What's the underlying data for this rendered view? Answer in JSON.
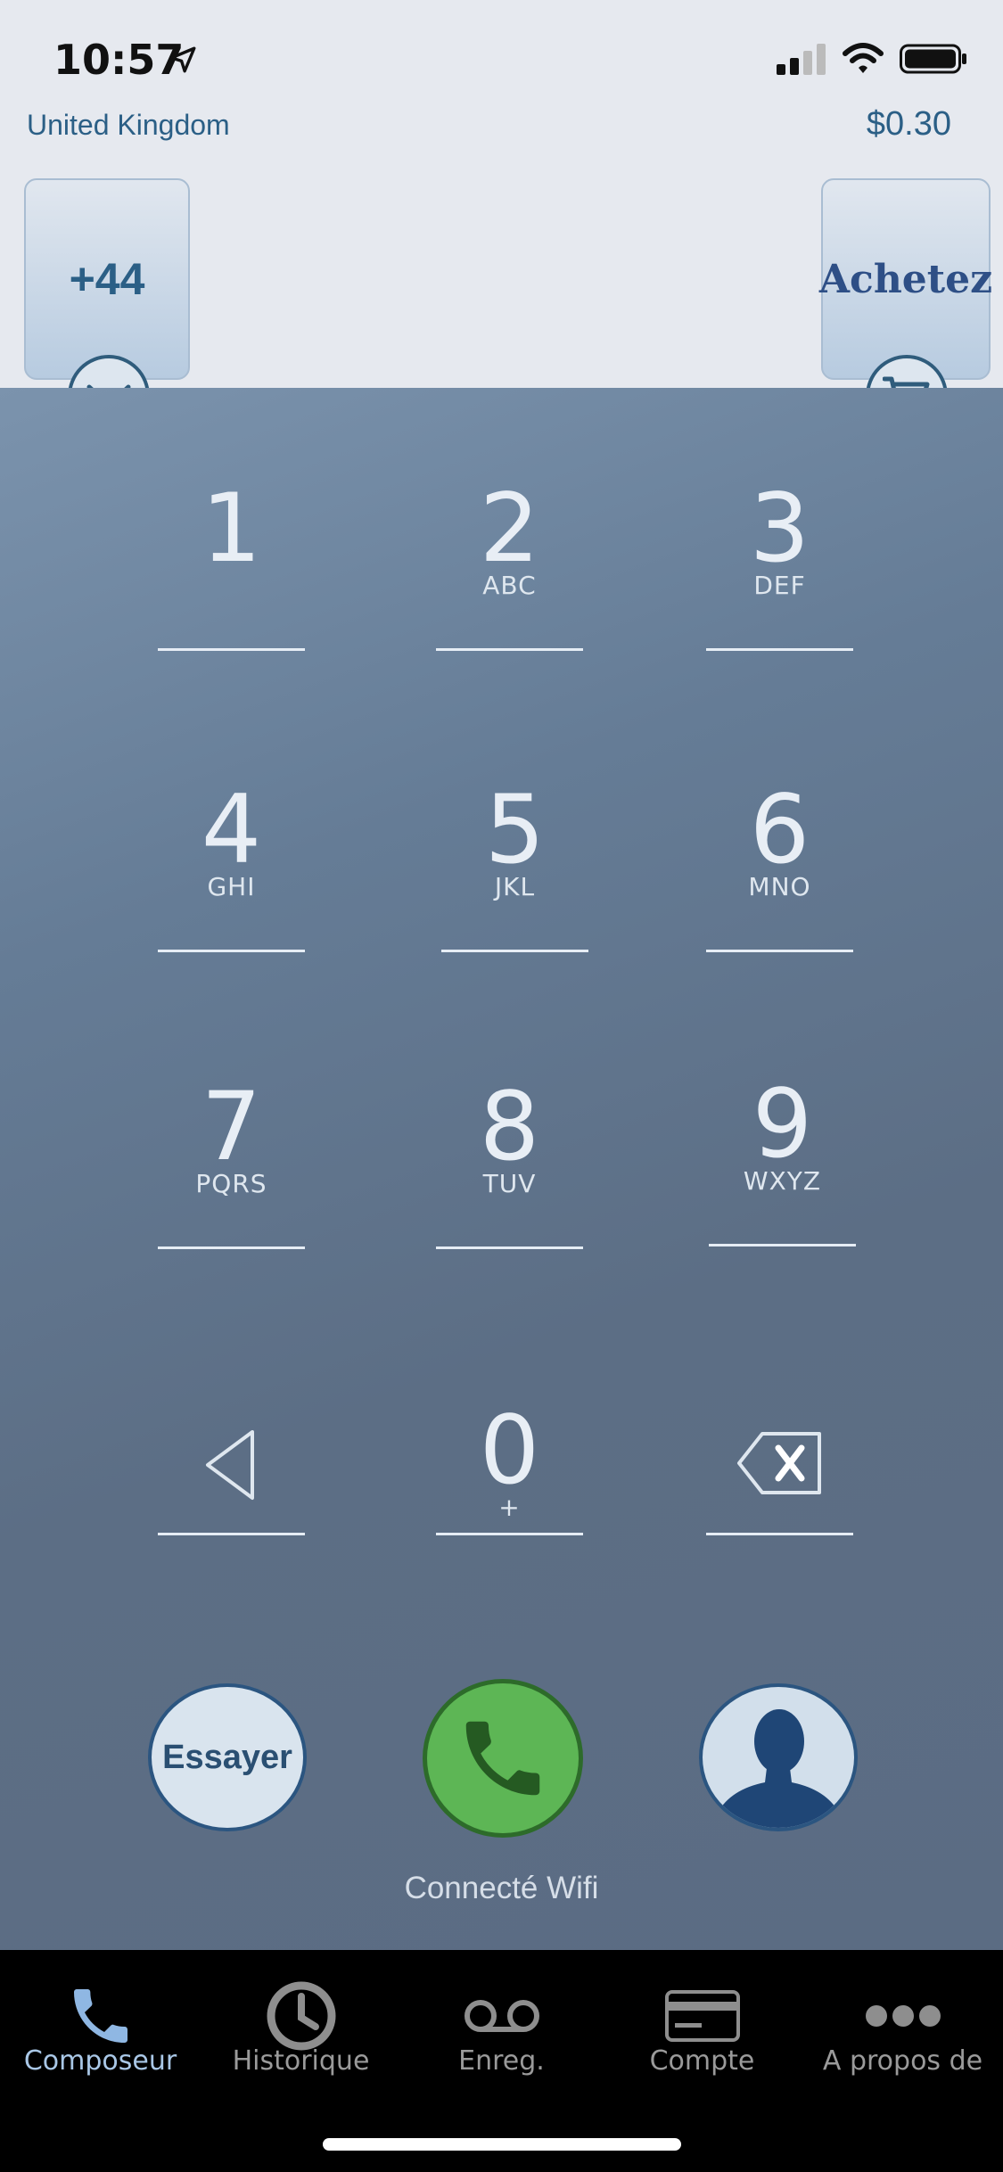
{
  "status_bar": {
    "time": "10:57"
  },
  "header": {
    "country": "United Kingdom",
    "credit": "$0.30",
    "country_code": "+44",
    "buy_label": "Achetez"
  },
  "keypad": {
    "keys": [
      {
        "num": "1",
        "letters": ""
      },
      {
        "num": "2",
        "letters": "ABC"
      },
      {
        "num": "3",
        "letters": "DEF"
      },
      {
        "num": "4",
        "letters": "GHI"
      },
      {
        "num": "5",
        "letters": "JKL"
      },
      {
        "num": "6",
        "letters": "MNO"
      },
      {
        "num": "7",
        "letters": "PQRS"
      },
      {
        "num": "8",
        "letters": "TUV"
      },
      {
        "num": "9",
        "letters": "WXYZ"
      },
      {
        "num": "0",
        "letters": "+"
      }
    ]
  },
  "actions": {
    "try_label": "Essayer",
    "connection_status": "Connecté Wifi"
  },
  "tabs": [
    {
      "label": "Composeur",
      "icon": "phone-icon",
      "active": true
    },
    {
      "label": "Historique",
      "icon": "clock-icon",
      "active": false
    },
    {
      "label": "Enreg.",
      "icon": "voicemail-icon",
      "active": false
    },
    {
      "label": "Compte",
      "icon": "card-icon",
      "active": false
    },
    {
      "label": "A propos de",
      "icon": "more-icon",
      "active": false
    }
  ],
  "colors": {
    "accent": "#2b5f86",
    "call_green": "#5db655",
    "active_tab": "#a9c7e6"
  }
}
